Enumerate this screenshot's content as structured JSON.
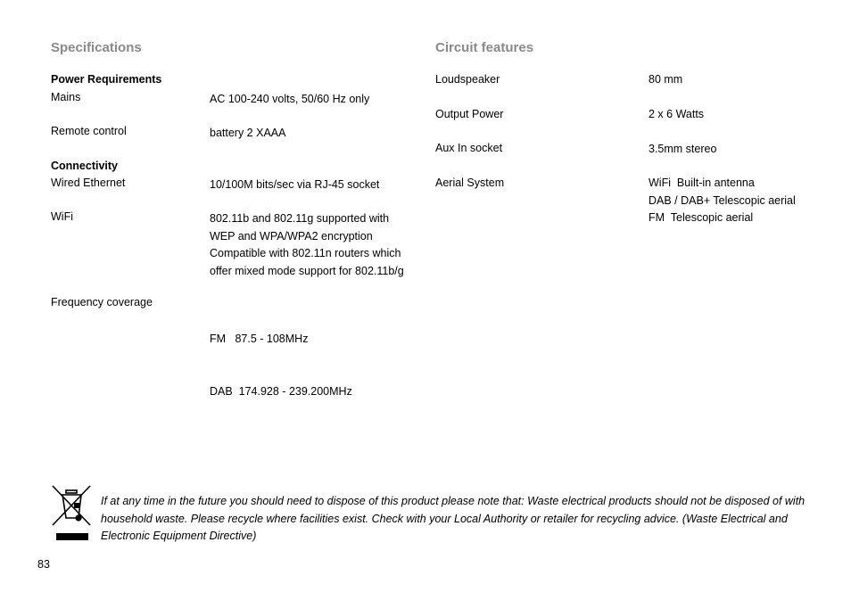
{
  "specifications": {
    "title": "Specifications",
    "power_heading": "Power Requirements",
    "mains": {
      "label": "Mains",
      "value": [
        "AC 100-240 volts, 50/60 Hz only"
      ]
    },
    "remote": {
      "label": "Remote control",
      "value": [
        "battery 2 XAAA"
      ]
    },
    "connectivity_heading": "Connectivity",
    "ethernet": {
      "label": "Wired Ethernet",
      "value": [
        "10/100M bits/sec via RJ-45 socket"
      ]
    },
    "wifi": {
      "label": "WiFi",
      "value": [
        "802.11b and 802.11g supported with",
        "WEP and WPA/WPA2 encryption",
        "Compatible with 802.11n routers which",
        "offer mixed mode support for 802.11b/g"
      ]
    },
    "frequency": {
      "label": "Frequency coverage",
      "value": [
        "FM   87.5 - 108MHz",
        "DAB  174.928 - 239.200MHz"
      ]
    }
  },
  "circuit": {
    "title": "Circuit features",
    "loudspeaker": {
      "label": "Loudspeaker",
      "value": [
        "80 mm"
      ]
    },
    "output": {
      "label": "Output Power",
      "value": [
        "2 x 6 Watts"
      ]
    },
    "aux": {
      "label": "Aux In socket",
      "value": [
        "3.5mm stereo"
      ]
    },
    "aerial": {
      "label": "Aerial System",
      "value": [
        "WiFi  Built-in antenna",
        "DAB / DAB+ Telescopic aerial",
        "FM  Telescopic aerial"
      ]
    }
  },
  "weee": {
    "icon": "crossed-out-wheelie-bin-icon",
    "text": "If at any time in the future you should need to dispose of this product please note that: Waste electrical products should not be disposed of with household waste. Please recycle where facilities exist. Check with your Local Authority or retailer for recycling advice. (Waste Electrical and Electronic Equipment Directive)"
  },
  "page_number": "83"
}
